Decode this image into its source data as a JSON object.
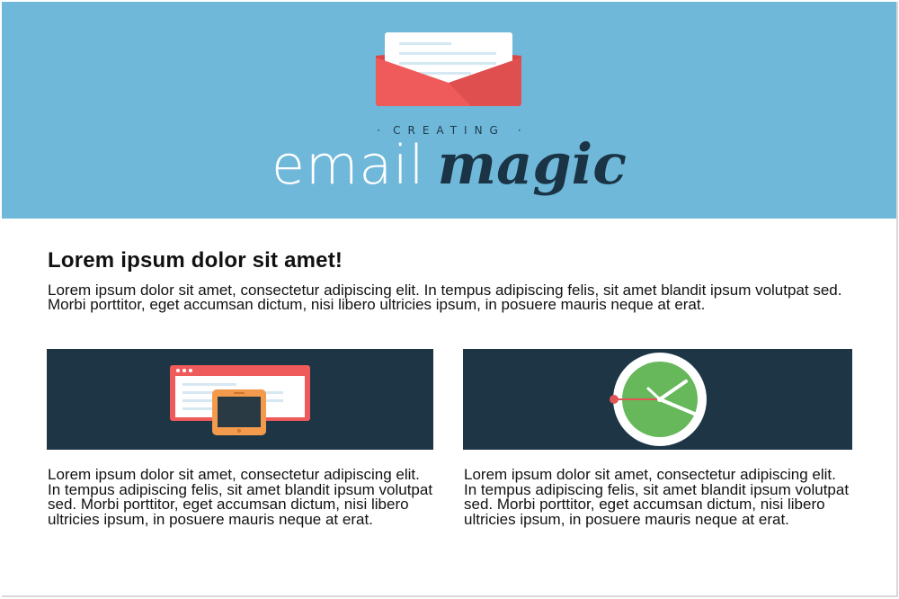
{
  "header": {
    "eyebrow": "CREATING",
    "logo_light": "email",
    "logo_bold": "magic",
    "colors": {
      "banner": "#6fb8d9",
      "envelope": "#ef5a5a",
      "logo_dark": "#1b3445"
    },
    "icon": "envelope-icon"
  },
  "content": {
    "headline": "Lorem ipsum dolor sit amet!",
    "intro": "Lorem ipsum dolor sit amet, consectetur adipiscing elit. In tempus adipiscing felis, sit amet blandit ipsum volutpat sed. Morbi porttitor, eget accumsan dictum, nisi libero ultricies ipsum, in posuere mauris neque at erat.",
    "columns": [
      {
        "icon": "browser-phone-icon",
        "text": "Lorem ipsum dolor sit amet, consectetur adipiscing elit. In tempus adipiscing felis, sit amet blandit ipsum volutpat sed. Morbi porttitor, eget accumsan dictum, nisi libero ultricies ipsum, in posuere mauris neque at erat."
      },
      {
        "icon": "clock-icon",
        "text": "Lorem ipsum dolor sit amet, consectetur adipiscing elit. In tempus adipiscing felis, sit amet blandit ipsum volutpat sed. Morbi porttitor, eget accumsan dictum, nisi libero ultricies ipsum, in posuere mauris neque at erat."
      }
    ],
    "colors": {
      "card_bg": "#1d3545",
      "text": "#111111"
    }
  }
}
